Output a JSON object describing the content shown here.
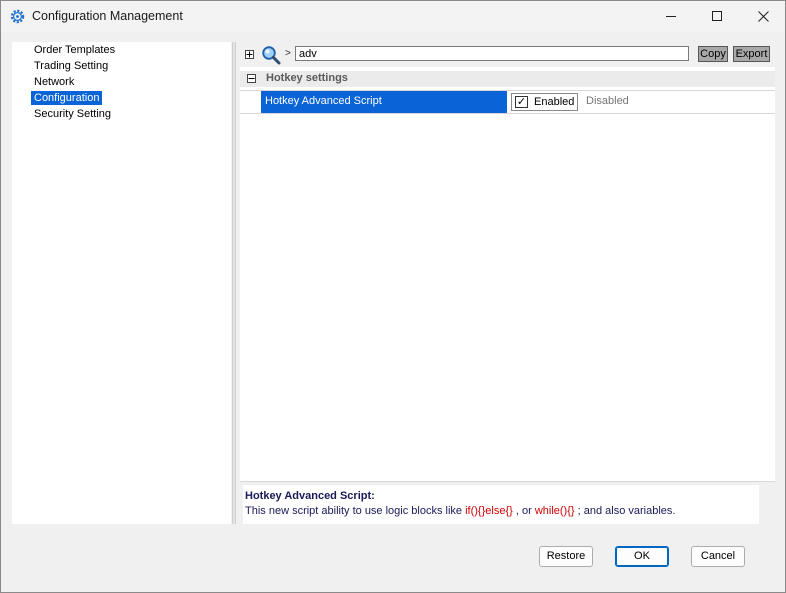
{
  "window": {
    "title": "Configuration Management",
    "icon": "gear-icon",
    "controls": {
      "minimize": "minimize-icon",
      "maximize": "maximize-icon",
      "close": "close-icon"
    }
  },
  "sidebar": {
    "items": [
      {
        "label": "Order Templates",
        "selected": false
      },
      {
        "label": "Trading Setting",
        "selected": false
      },
      {
        "label": "Network",
        "selected": false
      },
      {
        "label": "Configuration",
        "selected": true
      },
      {
        "label": "Security Setting",
        "selected": false
      }
    ]
  },
  "toolbar": {
    "search_value": "adv",
    "chevron": ">",
    "copy_label": "Copy",
    "export_label": "Export"
  },
  "grid": {
    "category": "Hotkey settings",
    "rows": [
      {
        "name": "Hotkey Advanced Script",
        "value": "Enabled",
        "checked": true,
        "checkmark": "✓",
        "alternate": "Disabled"
      }
    ]
  },
  "description": {
    "title": "Hotkey Advanced Script:",
    "text_1": "This new script ability to use logic blocks like ",
    "code_1": "if(){}else{}",
    "text_2": " , or ",
    "code_2": "while(){}",
    "text_3": " ; and also variables."
  },
  "buttons": {
    "restore": "Restore",
    "ok": "OK",
    "cancel": "Cancel"
  },
  "colors": {
    "selection": "#0a64d8",
    "code": "#d00000"
  }
}
